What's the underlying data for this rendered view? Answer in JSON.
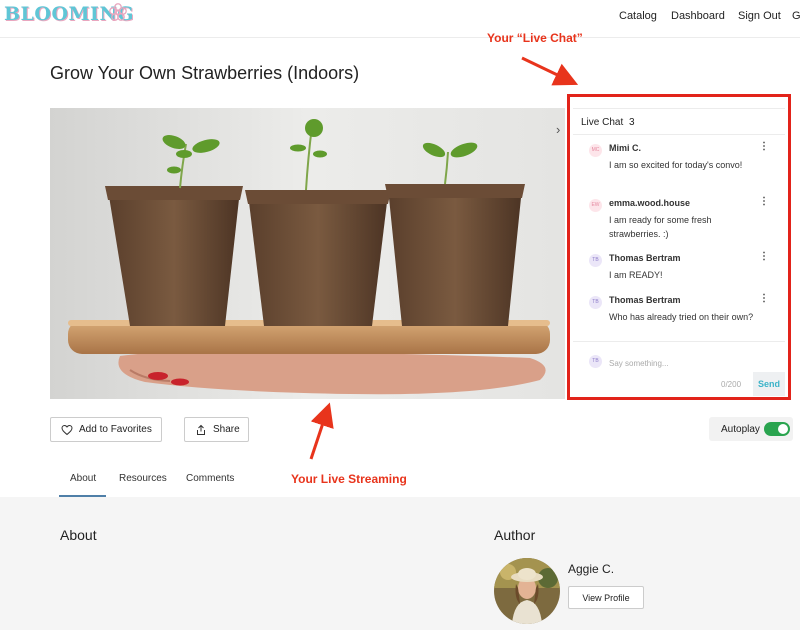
{
  "header": {
    "logo_text": "BLOOMING",
    "nav": [
      "Catalog",
      "Dashboard",
      "Sign Out",
      "G"
    ]
  },
  "page": {
    "title": "Grow Your Own Strawberries (Indoors)"
  },
  "chat": {
    "title": "Live Chat",
    "count": "3",
    "messages": [
      {
        "initials": "MC",
        "name": "Mimi C.",
        "text": "I am so excited for today's convo!",
        "avatar_color": "#fde5ea"
      },
      {
        "initials": "EW",
        "name": "emma.wood.house",
        "text": "I am ready for some fresh strawberries. :)",
        "avatar_color": "#fde5ea"
      },
      {
        "initials": "TB",
        "name": "Thomas Bertram",
        "text": "I am READY!",
        "avatar_color": "#ebe6f8"
      },
      {
        "initials": "TB",
        "name": "Thomas Bertram",
        "text": "Who has already tried on their own?",
        "avatar_color": "#ebe6f8"
      }
    ],
    "input_initials": "TB",
    "input_placeholder": "Say something...",
    "counter": "0/200",
    "send_label": "Send",
    "menu_glyph": "⋮"
  },
  "annotations": {
    "chat_label": "Your “Live Chat”",
    "stream_label": "Your Live Streaming",
    "color": "#e8341c"
  },
  "actions": {
    "favorites_label": "Add to Favorites",
    "share_label": "Share",
    "autoplay_label": "Autoplay",
    "autoplay_on": true
  },
  "tabs": [
    {
      "label": "About",
      "active": true
    },
    {
      "label": "Resources",
      "active": false
    },
    {
      "label": "Comments",
      "active": false
    }
  ],
  "about": {
    "title": "About"
  },
  "author": {
    "title": "Author",
    "name": "Aggie C.",
    "profile_button": "View Profile"
  },
  "icons": {
    "heart": "heart-icon",
    "share": "share-icon",
    "chevron": "chevron-right-icon",
    "flower": "flower-icon"
  },
  "colors": {
    "accent": "#3bb3c8",
    "toggle_on": "#2aa44f",
    "annotation_border": "#e2231a"
  }
}
